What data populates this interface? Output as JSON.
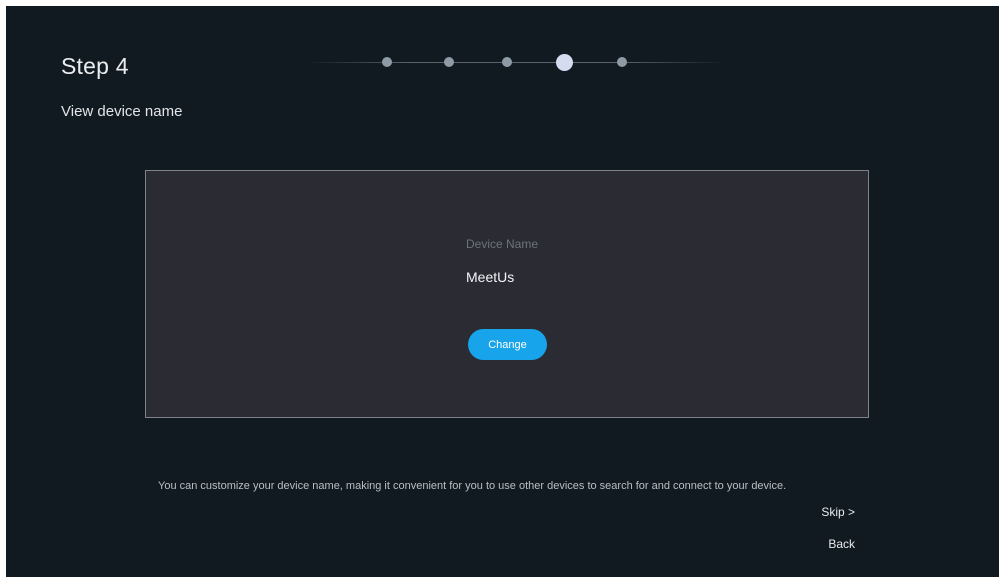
{
  "header": {
    "step_title": "Step 4",
    "step_subtitle": "View device name"
  },
  "stepper": {
    "total_steps": 5,
    "current_step": 4
  },
  "panel": {
    "field_label": "Device Name",
    "field_value": "MeetUs",
    "change_label": "Change"
  },
  "footer": {
    "hint": "You can customize your device name, making it convenient for you to use other devices to search for and connect to your device.",
    "skip_label": "Skip >",
    "back_label": "Back"
  },
  "colors": {
    "background": "#121a21",
    "panel": "#2b2c33",
    "accent": "#18a4ea",
    "active_dot": "#d6dcef",
    "inactive_dot": "#8e9aa5"
  }
}
